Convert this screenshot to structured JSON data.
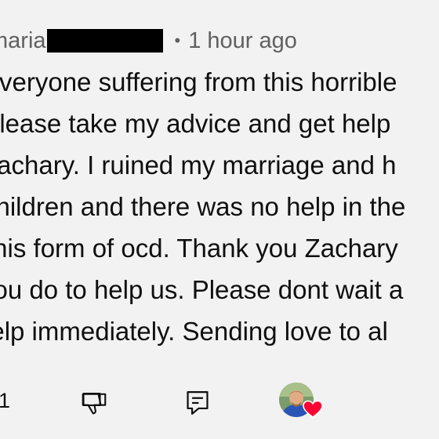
{
  "comment": {
    "author": "maria",
    "separator": "•",
    "timestamp": "1 hour ago",
    "lines": [
      "Everyone suffering from this horrible",
      "please take my advice and get help",
      "Zachary. I ruined my marriage and h",
      "children and there was no help in the",
      "this form of ocd. Thank you Zachary",
      "you do to help us. Please dont wait a",
      "help immediately. Sending love to al"
    ]
  },
  "actions": {
    "like_count": "1",
    "like_icon": "thumb-up-icon",
    "dislike_icon": "thumb-down-icon",
    "reply_icon": "reply-icon",
    "creator_heart_icon": "creator-heart-icon",
    "heart_color": "#ff0033"
  }
}
